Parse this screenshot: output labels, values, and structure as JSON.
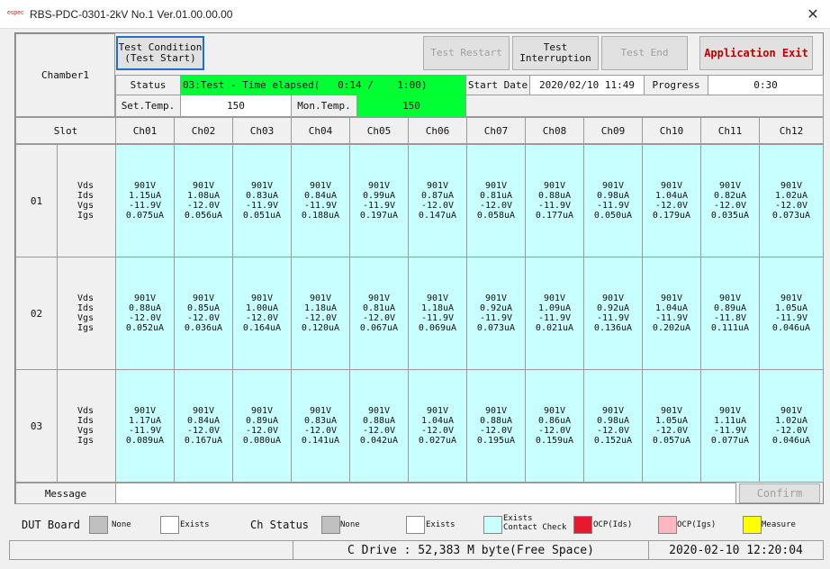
{
  "window": {
    "icon_text": "espec",
    "title": "RBS-PDC-0301-2kV No.1 Ver.01.00.00.00",
    "close_glyph": "✕"
  },
  "header": {
    "chamber": "Chamber1",
    "buttons": {
      "test_condition": "Test Condition\n(Test Start)",
      "test_restart": "Test Restart",
      "test_interruption": "Test\nInterruption",
      "test_end": "Test End",
      "app_exit": "Application Exit"
    },
    "status_label": "Status",
    "status_value": "03:Test - Time elapsed(   0:14 /    1:00)",
    "start_date_label": "Start Date",
    "start_date_value": "2020/02/10 11:49",
    "progress_label": "Progress",
    "progress_value": "0:30",
    "set_temp_label": "Set.Temp.",
    "set_temp_value": "150",
    "mon_temp_label": "Mon.Temp.",
    "mon_temp_value": "150"
  },
  "grid": {
    "slot_header": "Slot",
    "channels": [
      "Ch01",
      "Ch02",
      "Ch03",
      "Ch04",
      "Ch05",
      "Ch06",
      "Ch07",
      "Ch08",
      "Ch09",
      "Ch10",
      "Ch11",
      "Ch12"
    ],
    "param_labels": "Vds\nIds\nVgs\nIgs",
    "rows": [
      {
        "slot": "01",
        "cells": [
          "901V\n1.15uA\n-11.9V\n0.075uA",
          "901V\n1.08uA\n-12.0V\n0.056uA",
          "901V\n0.83uA\n-11.9V\n0.051uA",
          "901V\n0.84uA\n-11.9V\n0.188uA",
          "901V\n0.99uA\n-11.9V\n0.197uA",
          "901V\n0.87uA\n-12.0V\n0.147uA",
          "901V\n0.81uA\n-12.0V\n0.058uA",
          "901V\n0.88uA\n-11.9V\n0.177uA",
          "901V\n0.98uA\n-11.9V\n0.050uA",
          "901V\n1.04uA\n-12.0V\n0.179uA",
          "901V\n0.82uA\n-12.0V\n0.035uA",
          "901V\n1.02uA\n-12.0V\n0.073uA"
        ]
      },
      {
        "slot": "02",
        "cells": [
          "901V\n0.88uA\n-12.0V\n0.052uA",
          "901V\n0.85uA\n-12.0V\n0.036uA",
          "901V\n1.00uA\n-12.0V\n0.164uA",
          "901V\n1.18uA\n-12.0V\n0.120uA",
          "901V\n0.81uA\n-12.0V\n0.067uA",
          "901V\n1.18uA\n-11.9V\n0.069uA",
          "901V\n0.92uA\n-11.9V\n0.073uA",
          "901V\n1.09uA\n-11.9V\n0.021uA",
          "901V\n0.92uA\n-11.9V\n0.136uA",
          "901V\n1.04uA\n-11.9V\n0.202uA",
          "901V\n0.89uA\n-11.8V\n0.111uA",
          "901V\n1.05uA\n-11.9V\n0.046uA"
        ]
      },
      {
        "slot": "03",
        "cells": [
          "901V\n1.17uA\n-11.9V\n0.089uA",
          "901V\n0.84uA\n-12.0V\n0.167uA",
          "901V\n0.89uA\n-12.0V\n0.080uA",
          "901V\n0.83uA\n-12.0V\n0.141uA",
          "901V\n0.88uA\n-12.0V\n0.042uA",
          "901V\n1.04uA\n-12.0V\n0.027uA",
          "901V\n0.88uA\n-12.0V\n0.195uA",
          "901V\n0.86uA\n-12.0V\n0.159uA",
          "901V\n0.98uA\n-12.0V\n0.152uA",
          "901V\n1.05uA\n-12.0V\n0.057uA",
          "901V\n1.11uA\n-11.9V\n0.077uA",
          "901V\n1.02uA\n-12.0V\n0.046uA"
        ]
      }
    ]
  },
  "message": {
    "label": "Message",
    "value": "",
    "confirm": "Confirm"
  },
  "legend": {
    "dut_board": "DUT Board",
    "dut_items": [
      {
        "label": "None",
        "color": "#c0c0c0"
      },
      {
        "label": "Exists",
        "color": "#ffffff"
      }
    ],
    "ch_status": "Ch Status",
    "ch_items": [
      {
        "label": "None",
        "color": "#c0c0c0"
      },
      {
        "label": "Exists",
        "color": "#ffffff"
      },
      {
        "label": "Exists\nContact Check",
        "color": "#c8ffff"
      },
      {
        "label": "OCP(Ids)",
        "color": "#e8182f"
      },
      {
        "label": "OCP(Igs)",
        "color": "#ffb6c1"
      },
      {
        "label": "Measure",
        "color": "#ffff00"
      }
    ]
  },
  "statusbar": {
    "disk": "C Drive : 52,383 M byte(Free Space)",
    "clock": "2020-02-10 12:20:04"
  }
}
